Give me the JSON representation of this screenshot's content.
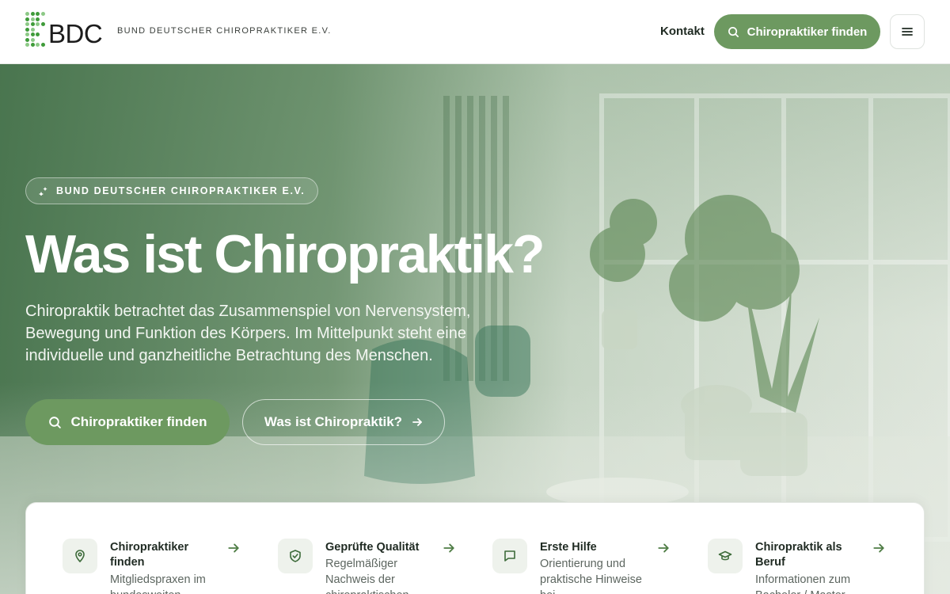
{
  "header": {
    "logo_text": "BDC",
    "org_name": "BUND DEUTSCHER CHIROPRAKTIKER E.V.",
    "nav_contact": "Kontakt",
    "cta_label": "Chiropraktiker finden",
    "menu_icon": "hamburger-icon"
  },
  "hero": {
    "badge": "BUND DEUTSCHER CHIROPRAKTIKER E.V.",
    "title": "Was ist Chiropraktik?",
    "lead": "Chiropraktik betrachtet das Zusammenspiel von Nervensystem, Bewegung und Funktion des Körpers. Im Mittelpunkt steht eine individuelle und ganzheitliche Betrachtung des Menschen.",
    "primary_button": "Chiropraktiker finden",
    "secondary_button": "Was ist Chiropraktik?"
  },
  "cards": [
    {
      "title": "Chiropraktiker finden",
      "desc": "Mitgliedspraxen im bundesweiten",
      "icon": "map-pin-icon"
    },
    {
      "title": "Geprüfte Qualität",
      "desc": "Regelmäßiger Nachweis der chiropraktischen",
      "icon": "shield-check-icon"
    },
    {
      "title": "Erste Hilfe",
      "desc": "Orientierung und praktische Hinweise bei",
      "icon": "chat-bubble-icon"
    },
    {
      "title": "Chiropraktik als Beruf",
      "desc": "Informationen zum Bachelor / Master",
      "icon": "graduation-cap-icon"
    }
  ],
  "colors": {
    "brand_green": "#6d9960",
    "logo_green": "#3f9b3a",
    "text_dark": "#1f2a22"
  }
}
